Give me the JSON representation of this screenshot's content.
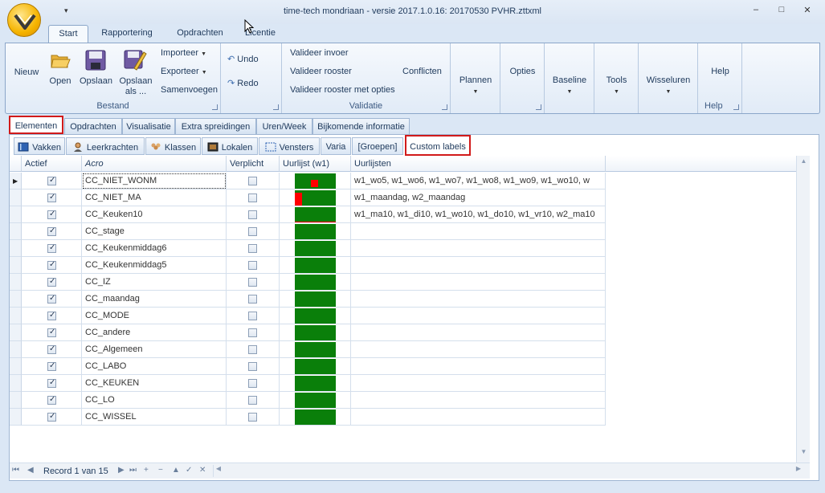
{
  "window": {
    "title": "time-tech mondriaan - versie 2017.1.0.16: 20170530 PVHR.zttxml",
    "qat_icon": "chevron-down-icon",
    "controls": {
      "minimize": "–",
      "maximize": "□",
      "close": "✕"
    }
  },
  "ribbon_tabs": [
    "Start",
    "Rapportering",
    "Opdrachten",
    "Licentie"
  ],
  "ribbon": {
    "bestand": {
      "label": "Bestand",
      "nieuw": "Nieuw",
      "open": "Open",
      "opslaan": "Opslaan",
      "opslaan_als_1": "Opslaan",
      "opslaan_als_2": "als ...",
      "importeer": "Importeer",
      "exporteer": "Exporteer",
      "samenvoegen": "Samenvoegen"
    },
    "undo": "Undo",
    "redo": "Redo",
    "validatie": {
      "label": "Validatie",
      "invoer": "Valideer invoer",
      "rooster": "Valideer rooster",
      "opties": "Valideer rooster met opties",
      "conflicten": "Conflicten"
    },
    "plannen": "Plannen",
    "opties": "Opties",
    "baseline": "Baseline",
    "tools": "Tools",
    "wisseluren": "Wisseluren",
    "help": "Help",
    "help_group": "Help"
  },
  "element_tabs": [
    "Elementen",
    "Opdrachten",
    "Visualisatie",
    "Extra spreidingen",
    "Uren/Week",
    "Bijkomende informatie"
  ],
  "sub_tabs": [
    {
      "label": "Vakken",
      "icon": "book-icon"
    },
    {
      "label": "Leerkrachten",
      "icon": "person-icon"
    },
    {
      "label": "Klassen",
      "icon": "group-icon"
    },
    {
      "label": "Lokalen",
      "icon": "room-icon"
    },
    {
      "label": "Vensters",
      "icon": "window-icon"
    },
    {
      "label": "Varia",
      "icon": ""
    },
    {
      "label": "[Groepen]",
      "icon": ""
    },
    {
      "label": "Custom labels",
      "icon": ""
    }
  ],
  "grid": {
    "headers": [
      "Actief",
      "Acro",
      "Verplicht",
      "Uurlijst (w1)",
      "Uurlijsten"
    ],
    "rows": [
      {
        "actief": true,
        "acro": "CC_NIET_WONM",
        "verplicht": false,
        "uurlijsten": "w1_wo5, w1_wo6, w1_wo7, w1_wo8, w1_wo9, w1_wo10, w"
      },
      {
        "actief": true,
        "acro": "CC_NIET_MA",
        "verplicht": false,
        "uurlijsten": "w1_maandag, w2_maandag"
      },
      {
        "actief": true,
        "acro": "CC_Keuken10",
        "verplicht": false,
        "uurlijsten": "w1_ma10, w1_di10, w1_wo10, w1_do10, w1_vr10, w2_ma10"
      },
      {
        "actief": true,
        "acro": "CC_stage",
        "verplicht": false,
        "uurlijsten": ""
      },
      {
        "actief": true,
        "acro": "CC_Keukenmiddag6",
        "verplicht": false,
        "uurlijsten": ""
      },
      {
        "actief": true,
        "acro": "CC_Keukenmiddag5",
        "verplicht": false,
        "uurlijsten": ""
      },
      {
        "actief": true,
        "acro": "CC_IZ",
        "verplicht": false,
        "uurlijsten": ""
      },
      {
        "actief": true,
        "acro": "CC_maandag",
        "verplicht": false,
        "uurlijsten": ""
      },
      {
        "actief": true,
        "acro": "CC_MODE",
        "verplicht": false,
        "uurlijsten": ""
      },
      {
        "actief": true,
        "acro": "CC_andere",
        "verplicht": false,
        "uurlijsten": ""
      },
      {
        "actief": true,
        "acro": "CC_Algemeen",
        "verplicht": false,
        "uurlijsten": ""
      },
      {
        "actief": true,
        "acro": "CC_LABO",
        "verplicht": false,
        "uurlijsten": ""
      },
      {
        "actief": true,
        "acro": "CC_KEUKEN",
        "verplicht": false,
        "uurlijsten": ""
      },
      {
        "actief": true,
        "acro": "CC_LO",
        "verplicht": false,
        "uurlijsten": ""
      },
      {
        "actief": true,
        "acro": "CC_WISSEL",
        "verplicht": false,
        "uurlijsten": ""
      }
    ]
  },
  "navigator": {
    "record_text": "Record 1 van 15",
    "first": "⏮",
    "prev": "◀",
    "next": "▶",
    "last": "⏭",
    "add": "+",
    "delete": "−",
    "up": "▲",
    "save": "✓",
    "cancel": "✕"
  },
  "colors": {
    "uurlijst_bar": "#0a7f0a",
    "uurlijst_marker": "#ff0000",
    "highlight_border": "#d11a1a"
  }
}
